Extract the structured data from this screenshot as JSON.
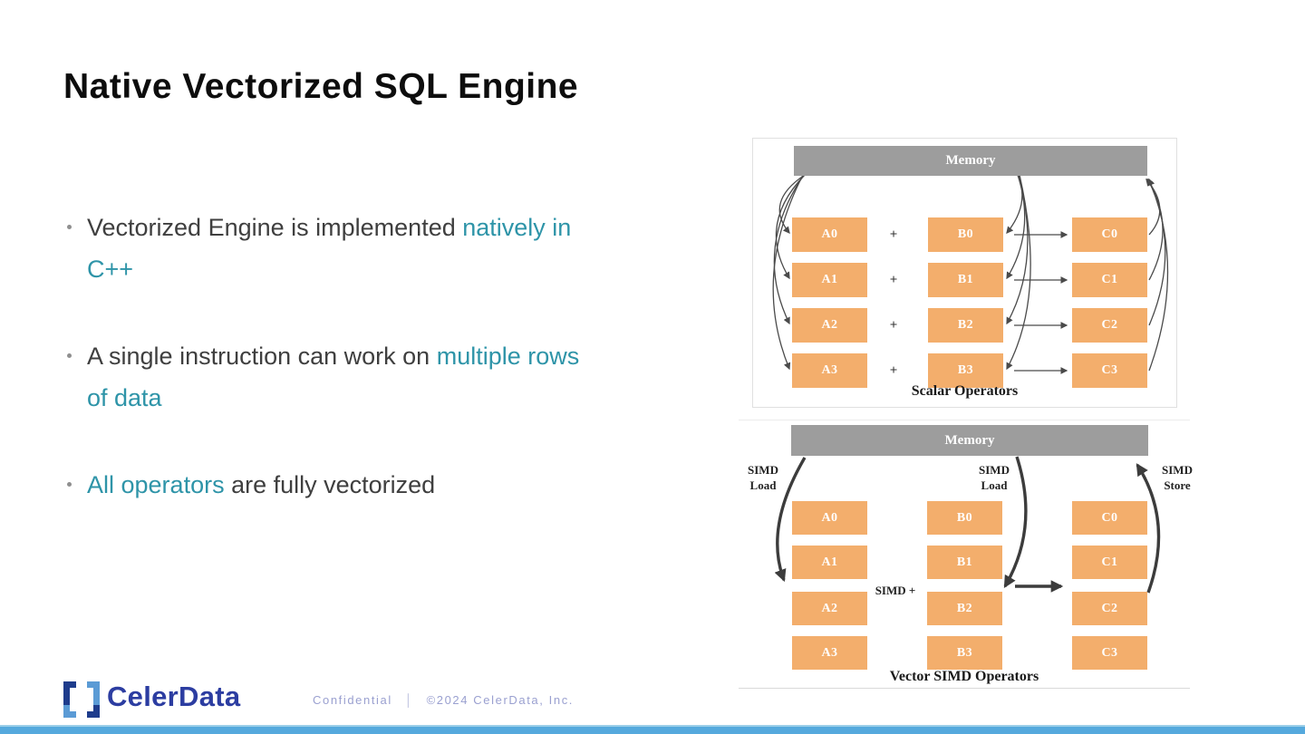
{
  "slide": {
    "title": "Native Vectorized SQL Engine",
    "bullets": [
      {
        "pre": "Vectorized Engine is implemented ",
        "highlight": "natively in\nC++",
        "post": ""
      },
      {
        "pre": "A single instruction can work on ",
        "highlight": "multiple rows\nof data",
        "post": ""
      },
      {
        "pre": "",
        "highlight": "All operators",
        "post": " are fully vectorized"
      }
    ],
    "colors": {
      "accent_teal": "#2e94a8",
      "box_orange": "#f3ae6c",
      "memory_gray": "#9d9d9d",
      "arrow_dark": "#3c3c3c",
      "bottom_bar_blue": "#55a9dd",
      "brand_dark_blue": "#2c3da1",
      "logo_navy": "#1e3c8c",
      "logo_sky": "#5b9bd5",
      "footer_text": "#9aa0d0"
    }
  },
  "diagrams": {
    "scalar": {
      "memory_label": "Memory",
      "operator": "+",
      "caption": "Scalar Operators",
      "columns": {
        "a": [
          "A0",
          "A1",
          "A2",
          "A3"
        ],
        "b": [
          "B0",
          "B1",
          "B2",
          "B3"
        ],
        "c": [
          "C0",
          "C1",
          "C2",
          "C3"
        ]
      }
    },
    "simd": {
      "memory_label": "Memory",
      "caption": "Vector SIMD Operators",
      "labels": {
        "load_left": "SIMD\nLoad",
        "load_mid": "SIMD\nLoad",
        "store": "SIMD\nStore",
        "op": "SIMD +"
      },
      "columns": {
        "a": [
          "A0",
          "A1",
          "A2",
          "A3"
        ],
        "b": [
          "B0",
          "B1",
          "B2",
          "B3"
        ],
        "c": [
          "C0",
          "C1",
          "C2",
          "C3"
        ]
      }
    }
  },
  "footer": {
    "brand": "CelerData",
    "confidential": "Confidential",
    "separator": "│",
    "copyright": "©2024 CelerData, Inc."
  }
}
